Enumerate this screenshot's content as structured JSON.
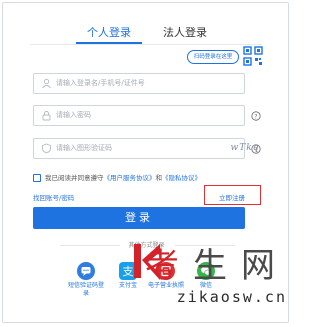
{
  "tabs": [
    {
      "label": "个人登录",
      "active": true
    },
    {
      "label": "法人登录",
      "active": false
    }
  ],
  "qr": {
    "bubble_text": "扫码登录在这里",
    "icon": "qr-code-icon"
  },
  "fields": {
    "account": {
      "placeholder": "请输入登录名/手机号/证件号",
      "icon": "user-icon"
    },
    "password": {
      "placeholder": "请输入密码",
      "icon": "lock-icon"
    },
    "captcha": {
      "placeholder": "请输入图形验证码",
      "icon": "shield-icon",
      "image_text": "wTkq"
    }
  },
  "agreement": {
    "prefix": "我已阅读并同意遵守",
    "service_link": "《用户服务协议》",
    "conj": "和",
    "privacy_link": "《隐私协议》",
    "checked": false
  },
  "links": {
    "find_account": "找回账号/密码",
    "register": "立即注册"
  },
  "login_button": "登录",
  "other_methods": {
    "label": "其他方式登录",
    "items": [
      {
        "label": "短信验证码登录",
        "icon": "sms-icon",
        "color": "#2f7de1"
      },
      {
        "label": "支付宝",
        "icon": "alipay-icon",
        "color": "#1aa0e8"
      },
      {
        "label": "电子营业执照",
        "icon": "license-icon",
        "color": "#d93333"
      },
      {
        "label": "微信",
        "icon": "wechat-icon",
        "color": "#35b54a"
      }
    ]
  },
  "watermark": {
    "chars": [
      "考",
      "生",
      "网"
    ],
    "url": "zikaosw.cn"
  },
  "colors": {
    "accent": "#1f73e0",
    "highlight": "#e03232",
    "border": "#cfd5dd"
  }
}
